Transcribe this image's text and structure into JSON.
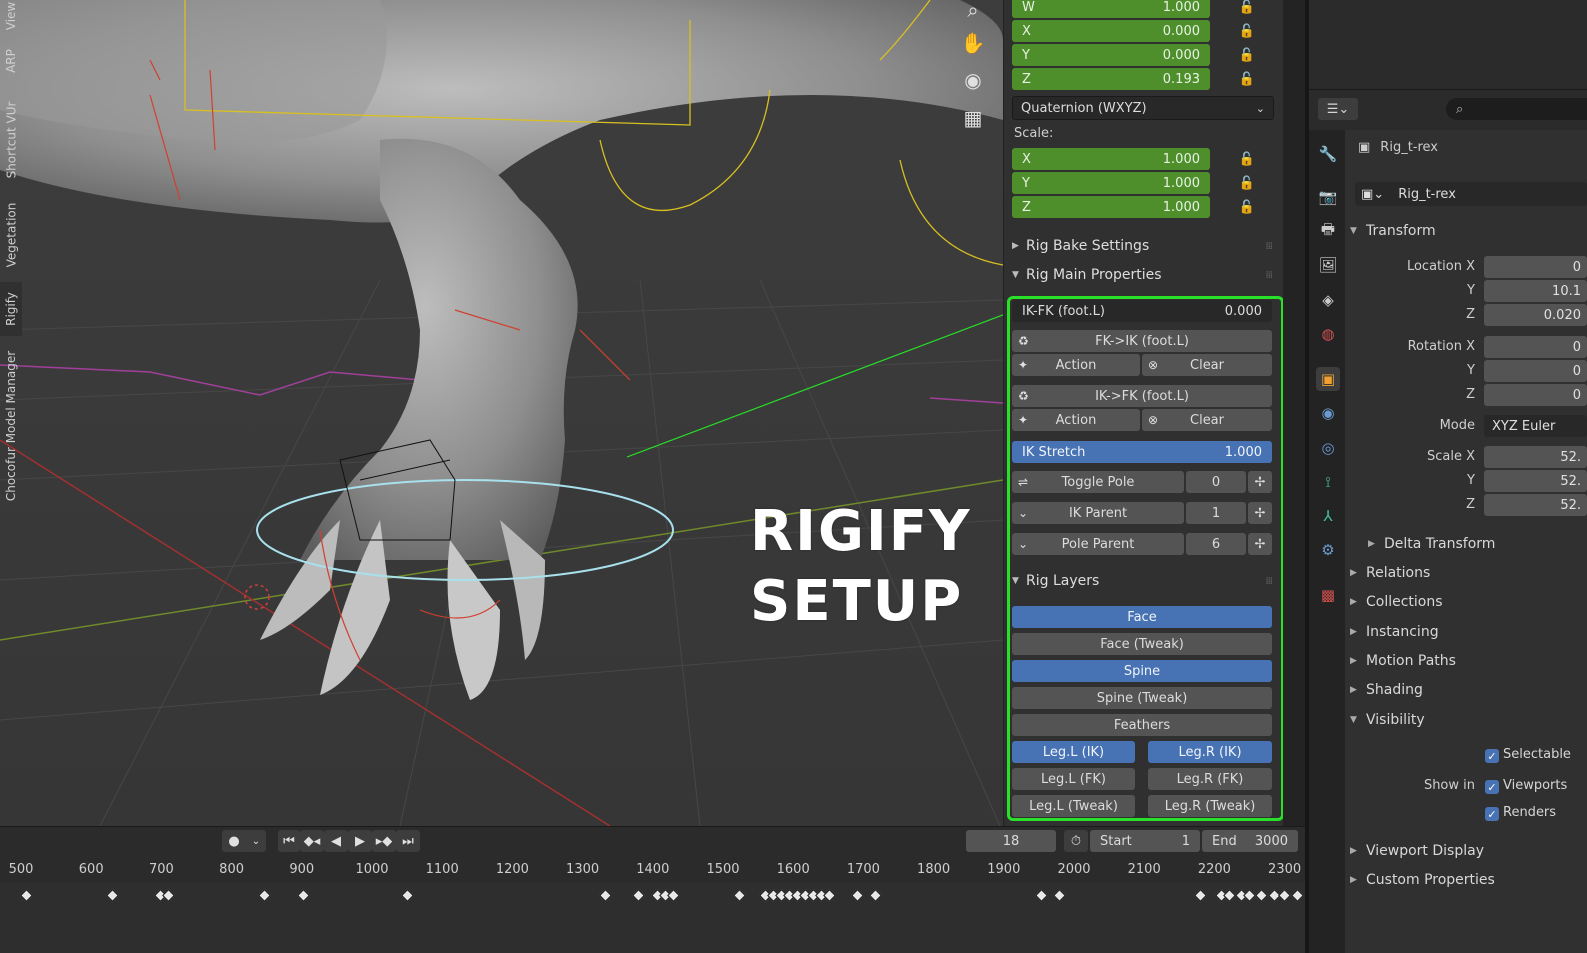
{
  "overlay": {
    "line1": "RIGIFY",
    "line2": "SETUP"
  },
  "viewport_nav": [
    {
      "name": "zoom-icon",
      "glyph": "⌕"
    },
    {
      "name": "hand-pan-icon",
      "glyph": "✋"
    },
    {
      "name": "camera-icon",
      "glyph": "🎥"
    },
    {
      "name": "grid-icon",
      "glyph": "▦"
    }
  ],
  "rotation": {
    "w": {
      "label": "W",
      "value": "1.000"
    },
    "x": {
      "label": "X",
      "value": "0.000"
    },
    "y": {
      "label": "Y",
      "value": "0.000"
    },
    "z": {
      "label": "Z",
      "value": "0.193"
    },
    "mode": "Quaternion (WXYZ)"
  },
  "scale": {
    "label": "Scale:",
    "x": {
      "label": "X",
      "value": "1.000"
    },
    "y": {
      "label": "Y",
      "value": "1.000"
    },
    "z": {
      "label": "Z",
      "value": "1.000"
    }
  },
  "sections": {
    "rig_bake": "Rig Bake Settings",
    "rig_main": "Rig Main Properties",
    "rig_layers": "Rig Layers"
  },
  "ikfk": {
    "slider_label": "IK-FK (foot.L)",
    "slider_value": "0.000",
    "fk_to_ik": "FK->IK (foot.L)",
    "ik_to_fk": "IK->FK (foot.L)",
    "action": "Action",
    "clear": "Clear",
    "ik_stretch_label": "IK Stretch",
    "ik_stretch_value": "1.000",
    "ik_stretch_fraction": 1.0,
    "toggle_pole": "Toggle Pole",
    "toggle_pole_value": "0",
    "ik_parent": "IK Parent",
    "ik_parent_value": "1",
    "pole_parent": "Pole Parent",
    "pole_parent_value": "6"
  },
  "layers": {
    "face": "Face",
    "face_tweak": "Face (Tweak)",
    "spine": "Spine",
    "spine_tweak": "Spine (Tweak)",
    "feathers": "Feathers",
    "leg_l_ik": "Leg.L (IK)",
    "leg_r_ik": "Leg.R (IK)",
    "leg_l_fk": "Leg.L (FK)",
    "leg_r_fk": "Leg.R (FK)",
    "leg_l_tweak": "Leg.L (Tweak)",
    "leg_r_tweak": "Leg.R (Tweak)"
  },
  "side_tabs": [
    "View",
    "ARP",
    "Shortcut VUr",
    "Vegetation",
    "Rigify",
    "Chocofur Model Manager"
  ],
  "timeline": {
    "current_frame": "18",
    "start_label": "Start",
    "start_value": "1",
    "end_label": "End",
    "end_value": "3000",
    "ticks": [
      "500",
      "600",
      "700",
      "800",
      "900",
      "1000",
      "1100",
      "1200",
      "1300",
      "1400",
      "1500",
      "1600",
      "1700",
      "1800",
      "1900",
      "2000",
      "2100",
      "2200",
      "2300"
    ]
  },
  "properties": {
    "object_name": "Rig_t-rex",
    "data_name": "Rig_t-rex",
    "transform": "Transform",
    "location_x_label": "Location X",
    "location_x": "0",
    "location_y_label": "Y",
    "location_y": "10.1",
    "location_z_label": "Z",
    "location_z": "0.020",
    "rotation_x_label": "Rotation X",
    "rotation_x": "0",
    "rotation_y_label": "Y",
    "rotation_y": "0",
    "rotation_z_label": "Z",
    "rotation_z": "0",
    "mode_label": "Mode",
    "mode_value": "XYZ Euler",
    "scale_x_label": "Scale X",
    "scale_x": "52.",
    "scale_y_label": "Y",
    "scale_y": "52.",
    "scale_z_label": "Z",
    "scale_z": "52.",
    "delta_transform": "Delta Transform",
    "relations": "Relations",
    "collections": "Collections",
    "instancing": "Instancing",
    "motion_paths": "Motion Paths",
    "shading": "Shading",
    "visibility": "Visibility",
    "selectable": "Selectable",
    "show_in": "Show in",
    "viewports": "Viewports",
    "renders": "Renders",
    "viewport_display": "Viewport Display",
    "custom_properties": "Custom Properties"
  }
}
